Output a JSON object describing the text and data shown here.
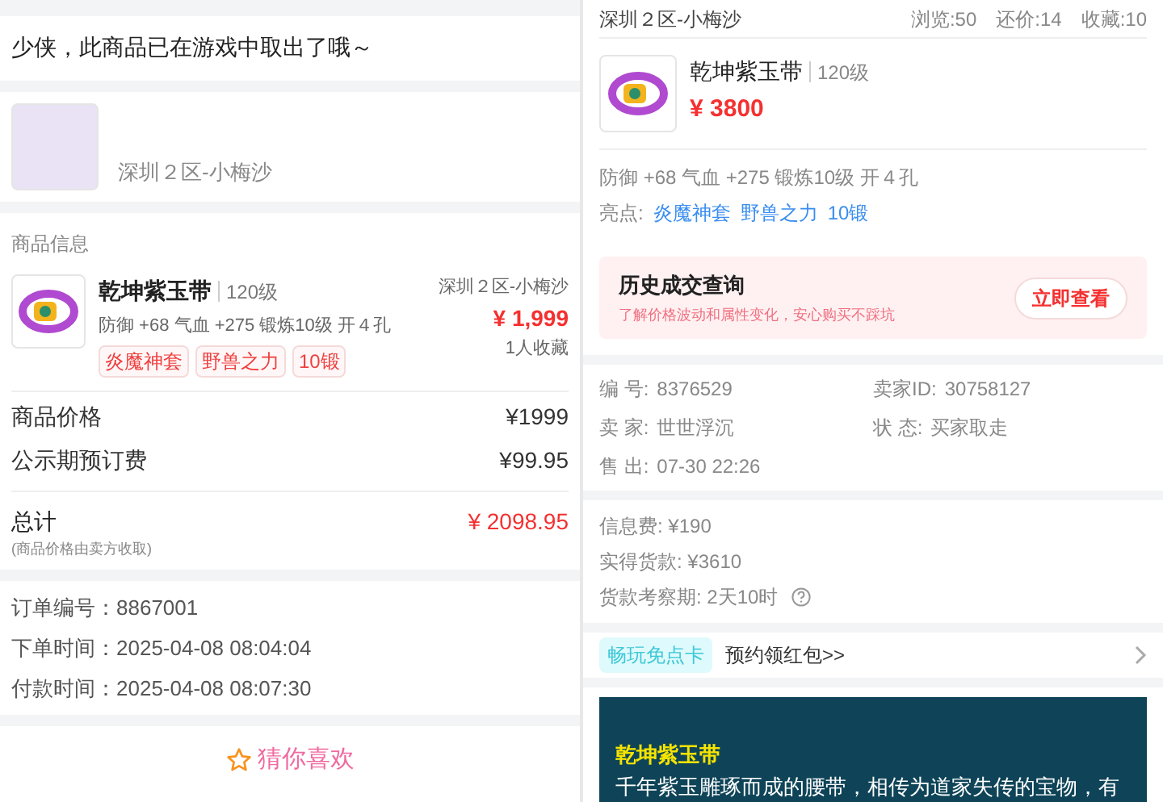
{
  "left": {
    "notice": "少侠，此商品已在游戏中取出了哦～",
    "seller": {
      "server": "深圳２区-小梅沙"
    },
    "product_section": {
      "title": "商品信息",
      "name": "乾坤紫玉带",
      "level": "120级",
      "server": "深圳２区-小梅沙",
      "attrs": "防御 +68 气血 +275 锻炼10级 开４孔",
      "price": "¥ 1,999",
      "favorites": "1人收藏",
      "tags": [
        "炎魔神套",
        "野兽之力",
        "10锻"
      ]
    },
    "price_rows": [
      {
        "label": "商品价格",
        "value": "¥1999"
      },
      {
        "label": "公示期预订费",
        "value": "¥99.95"
      }
    ],
    "total": {
      "label": "总计",
      "note": "(商品价格由卖方收取)",
      "value": "¥ 2098.95"
    },
    "order_info": [
      {
        "label": "订单编号：",
        "value": "8867001"
      },
      {
        "label": "下单时间：",
        "value": "2025-04-08 08:04:04"
      },
      {
        "label": "付款时间：",
        "value": "2025-04-08 08:07:30"
      }
    ],
    "recommend_title": "猜你喜欢"
  },
  "right": {
    "header": {
      "server": "深圳２区-小梅沙",
      "stats": [
        "浏览:50",
        "还价:14",
        "收藏:10"
      ]
    },
    "item": {
      "name": "乾坤紫玉带",
      "level": "120级",
      "price": "¥ 3800"
    },
    "attrs": "防御 +68 气血 +275 锻炼10级 开４孔",
    "highlights_label": "亮点:",
    "highlights": [
      "炎魔神套",
      "野兽之力",
      "10锻"
    ],
    "history": {
      "title": "历史成交查询",
      "subtitle": "了解价格波动和属性变化，安心购买不踩坑",
      "button": "立即查看"
    },
    "details": [
      {
        "label": "编 号:",
        "value": "8376529"
      },
      {
        "label": "卖家ID:",
        "value": "30758127"
      },
      {
        "label": "卖 家:",
        "value": "世世浮沉"
      },
      {
        "label": "状 态:",
        "value": "买家取走"
      },
      {
        "label": "售 出:",
        "value": "07-30 22:26"
      }
    ],
    "fees": [
      {
        "text": "信息费: ¥190",
        "help": false
      },
      {
        "text": "实得货款: ¥3610",
        "help": false
      },
      {
        "text": "货款考察期: 2天10时",
        "help": true
      }
    ],
    "promo": {
      "badge": "畅玩免点卡",
      "text": "预约领红包>>"
    },
    "description": {
      "title": "乾坤紫玉带",
      "text": "千年紫玉雕琢而成的腰带，相传为道家失传的宝物，有"
    }
  }
}
